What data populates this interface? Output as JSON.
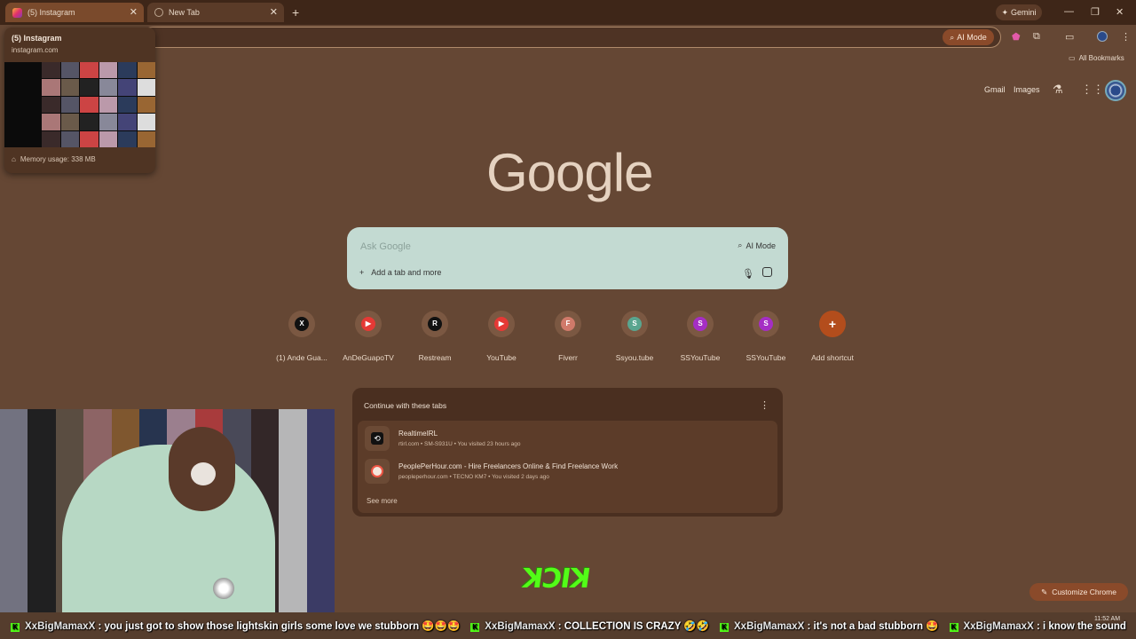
{
  "tabs": [
    {
      "title": "(5) Instagram"
    },
    {
      "title": "New Tab"
    }
  ],
  "gemini_label": "Gemini",
  "toolbar": {
    "ai_mode_label": "AI Mode",
    "all_bookmarks": "All Bookmarks"
  },
  "hover_card": {
    "title": "(5) Instagram",
    "url": "instagram.com",
    "memory": "Memory usage: 338 MB"
  },
  "header_links": {
    "gmail": "Gmail",
    "images": "Images"
  },
  "logo_text": "Google",
  "search": {
    "placeholder": "Ask Google",
    "ai_mode": "AI Mode",
    "add_tab": "Add a tab and more"
  },
  "shortcuts": [
    {
      "label": "(1) Ande Gua...",
      "glyph": "X",
      "color": "#111111"
    },
    {
      "label": "AnDeGuapoTV",
      "glyph": "▶",
      "color": "#e53935"
    },
    {
      "label": "Restream",
      "glyph": "R",
      "color": "#111111"
    },
    {
      "label": "YouTube",
      "glyph": "▶",
      "color": "#e53935"
    },
    {
      "label": "Fiverr",
      "glyph": "F",
      "color": "#d07a6a"
    },
    {
      "label": "Ssyou.tube",
      "glyph": "S",
      "color": "#5aa58f"
    },
    {
      "label": "SSYouTube",
      "glyph": "S",
      "color": "#a52ec4"
    },
    {
      "label": "SSYouTube",
      "glyph": "S",
      "color": "#a52ec4"
    },
    {
      "label": "Add shortcut",
      "glyph": "+",
      "color": "#b34d1c"
    }
  ],
  "continue_tabs": {
    "heading": "Continue with these tabs",
    "items": [
      {
        "title": "RealtimeIRL",
        "meta": "rtirl.com • SM-S931U • You visited 23 hours ago"
      },
      {
        "title": "PeoplePerHour.com - Hire Freelancers Online & Find Freelance Work",
        "meta": "peopleperhour.com • TECNO KM7 • You visited 2 days ago"
      }
    ],
    "see_more": "See more"
  },
  "kick_logo": "KICK",
  "customize_label": "Customize Chrome",
  "ticker": [
    {
      "user": "XxBigMamaxX",
      "msg": ": you just got to show those lightskin girls some love we stubborn 🤩🤩🤩"
    },
    {
      "user": "XxBigMamaxX",
      "msg": ": COLLECTION IS CRAZY 🤣🤣"
    },
    {
      "user": "XxBigMamaxX",
      "msg": ": it's not a bad stubborn 🤩"
    },
    {
      "user": "XxBigMamaxX",
      "msg": ": i know the sound"
    }
  ],
  "clock": "11:52 AM"
}
